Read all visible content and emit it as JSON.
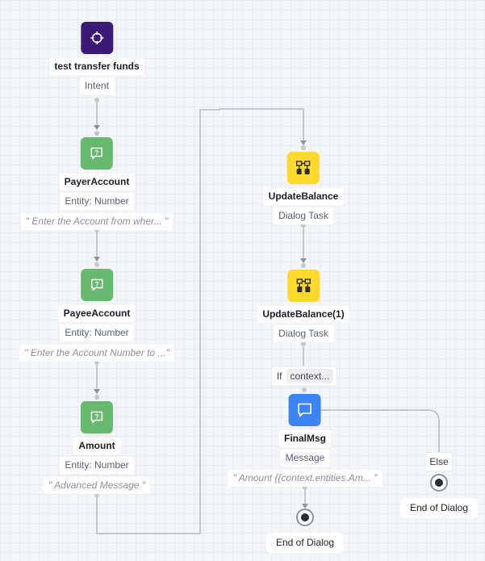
{
  "colors": {
    "intent": "#3c1a78",
    "entity": "#66b96e",
    "dialog_task": "#ffd92b",
    "message": "#3b86f4",
    "edge": "#b7bac2",
    "port": "#c6c8cd"
  },
  "nodes": {
    "intent": {
      "title": "test transfer funds",
      "type_label": "Intent",
      "icon": "crosshair-icon"
    },
    "payer_account": {
      "title": "PayerAccount",
      "type_label": "Entity: Number",
      "prompt": "Enter the Account from wher...",
      "icon": "question-bubble-icon"
    },
    "payee_account": {
      "title": "PayeeAccount",
      "type_label": "Entity: Number",
      "prompt": "Enter the Account Number to ...",
      "icon": "question-bubble-icon"
    },
    "amount": {
      "title": "Amount",
      "type_label": "Entity: Number",
      "prompt": "Advanced Message",
      "icon": "question-bubble-icon"
    },
    "update_balance": {
      "title": "UpdateBalance",
      "type_label": "Dialog Task",
      "icon": "flow-icon"
    },
    "update_balance_1": {
      "title": "UpdateBalance(1)",
      "type_label": "Dialog Task",
      "icon": "flow-icon"
    },
    "final_msg": {
      "title": "FinalMsg",
      "type_label": "Message",
      "prompt": "Amount {{context.entities.Am...",
      "icon": "message-bubble-icon"
    }
  },
  "condition": {
    "keyword": "If",
    "value": "context..."
  },
  "else_label": "Else",
  "end_nodes": [
    {
      "label": "End of Dialog"
    },
    {
      "label": "End of Dialog"
    }
  ],
  "quote_open": "\"",
  "quote_close": "\""
}
